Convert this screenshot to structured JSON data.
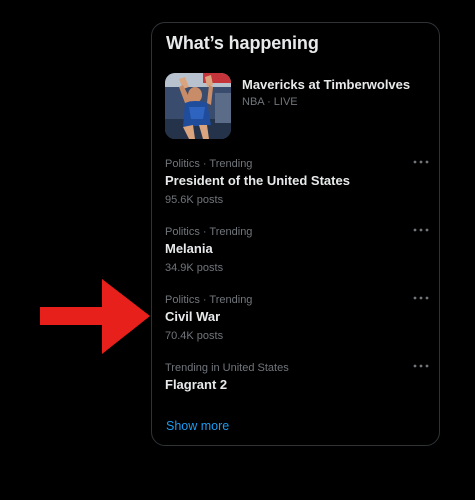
{
  "panel": {
    "title": "What’s happening"
  },
  "live_event": {
    "title": "Mavericks at Timberwolves",
    "subtitle": "NBA · LIVE"
  },
  "trends": [
    {
      "category": "Politics · Trending",
      "name": "President of the United States",
      "posts": "95.6K posts"
    },
    {
      "category": "Politics · Trending",
      "name": "Melania",
      "posts": "34.9K posts"
    },
    {
      "category": "Politics · Trending",
      "name": "Civil War",
      "posts": "70.4K posts"
    },
    {
      "category": "Trending in United States",
      "name": "Flagrant 2",
      "posts": ""
    }
  ],
  "show_more_label": "Show more",
  "colors": {
    "background": "#000000",
    "panel_border": "#2f3336",
    "primary_text": "#e7e9ea",
    "secondary_text": "#71767b",
    "link": "#1d9bf0",
    "annotation_arrow": "#e8201c"
  },
  "icons": {
    "more": "ellipsis-horizontal-icon",
    "annotation": "red-arrow-pointing-right"
  }
}
